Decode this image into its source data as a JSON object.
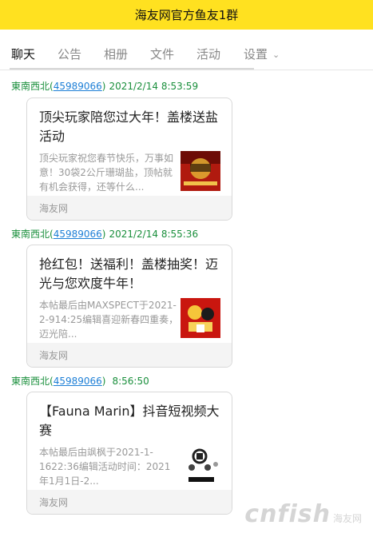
{
  "header": {
    "title": "海友网官方鱼友1群"
  },
  "tabs": [
    {
      "label": "聊天",
      "active": true
    },
    {
      "label": "公告"
    },
    {
      "label": "相册"
    },
    {
      "label": "文件"
    },
    {
      "label": "活动"
    },
    {
      "label": "设置"
    }
  ],
  "messages": [
    {
      "sender": "東南西北",
      "uid": "45989066",
      "time": "2021/2/14 8:53:59",
      "card": {
        "title": "顶尖玩家陪您过大年！盖楼送盐活动",
        "desc": "顶尖玩家祝您春节快乐，万事如意！30袋2公斤珊瑚盐，顶帖就有机会获得，还等什么...",
        "source": "海友网"
      }
    },
    {
      "sender": "東南西北",
      "uid": "45989066",
      "time": "2021/2/14 8:55:36",
      "card": {
        "title": "抢红包！送福利！盖楼抽奖！迈光与您欢度牛年！",
        "desc": "本帖最后由MAXSPECT于2021-2-914:25编辑喜迎新春四重奏，迈光陪...",
        "source": "海友网"
      }
    },
    {
      "sender": "東南西北",
      "uid": "45989066",
      "time": "8:56:50",
      "card": {
        "title": "【Fauna Marin】抖音短视频大赛",
        "desc": "本帖最后由飒枫于2021-1-1622:36编辑活动时间：2021年1月1日-2...",
        "source": "海友网"
      }
    }
  ],
  "watermark": {
    "main": "cnfish",
    "sub": "海友网"
  },
  "colors": {
    "header_bg": "#ffe120",
    "sender_green": "#1a8f3c",
    "uid_blue": "#1e7fd6"
  },
  "icons": {
    "dropdown": "chevron-down-icon"
  }
}
